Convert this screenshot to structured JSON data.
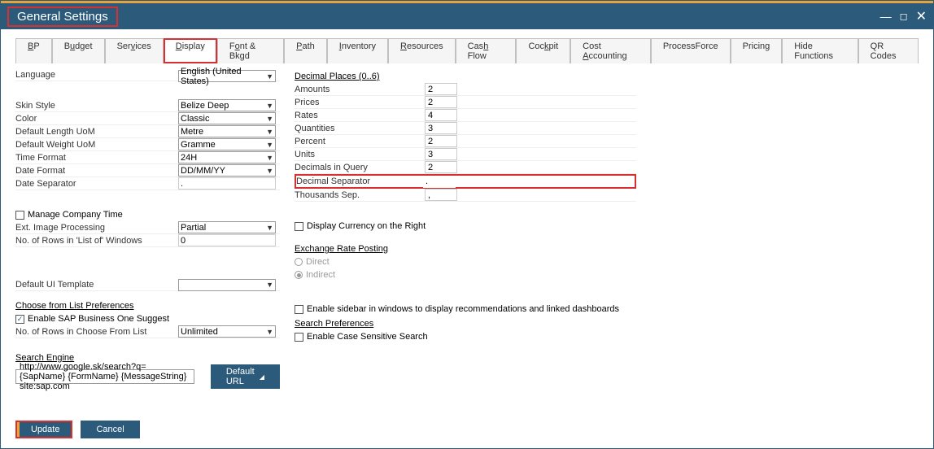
{
  "window": {
    "title": "General Settings"
  },
  "tabs": [
    "BP",
    "Budget",
    "Services",
    "Display",
    "Font & Bkgd",
    "Path",
    "Inventory",
    "Resources",
    "Cash Flow",
    "Cockpit",
    "Cost Accounting",
    "ProcessForce",
    "Pricing",
    "Hide Functions",
    "QR Codes"
  ],
  "left": {
    "language_lbl": "Language",
    "language_val": "English (United States)",
    "skin_lbl": "Skin Style",
    "skin_val": "Belize Deep",
    "color_lbl": "Color",
    "color_val": "Classic",
    "len_lbl": "Default Length UoM",
    "len_val": "Metre",
    "wt_lbl": "Default Weight UoM",
    "wt_val": "Gramme",
    "time_lbl": "Time Format",
    "time_val": "24H",
    "date_lbl": "Date Format",
    "date_val": "DD/MM/YY",
    "datesep_lbl": "Date Separator",
    "datesep_val": ".",
    "manage_lbl": "Manage Company Time",
    "ext_lbl": "Ext. Image Processing",
    "ext_val": "Partial",
    "rows_lbl": "No. of Rows in 'List of' Windows",
    "rows_val": "0",
    "ui_lbl": "Default UI Template",
    "ui_val": "",
    "cflp_header": "Choose from List Preferences",
    "suggest_lbl": "Enable SAP Business One Suggest",
    "cfl_rows_lbl": "No. of Rows in Choose From List",
    "cfl_rows_val": "Unlimited",
    "search_engine_lbl": "Search Engine",
    "search_engine_val": "http://www.google.sk/search?q={SapName} {FormName} {MessageString} site:sap.com",
    "default_url_btn": "Default URL"
  },
  "right": {
    "dp_header": "Decimal Places  (0..6)",
    "amounts_lbl": "Amounts",
    "amounts_val": "2",
    "prices_lbl": "Prices",
    "prices_val": "2",
    "rates_lbl": "Rates",
    "rates_val": "4",
    "qty_lbl": "Quantities",
    "qty_val": "3",
    "pct_lbl": "Percent",
    "pct_val": "2",
    "units_lbl": "Units",
    "units_val": "3",
    "dq_lbl": "Decimals in Query",
    "dq_val": "2",
    "dsep_lbl": "Decimal Separator",
    "dsep_val": ".",
    "tsep_lbl": "Thousands Sep.",
    "tsep_val": ",",
    "disp_curr_lbl": "Display Currency on the Right",
    "erp_header": "Exchange Rate Posting",
    "erp_direct": "Direct",
    "erp_indirect": "Indirect",
    "sidebar_lbl": "Enable sidebar in windows to display recommendations and linked dashboards",
    "sp_header": "Search Preferences",
    "case_lbl": "Enable Case Sensitive Search"
  },
  "footer": {
    "update": "Update",
    "cancel": "Cancel"
  }
}
